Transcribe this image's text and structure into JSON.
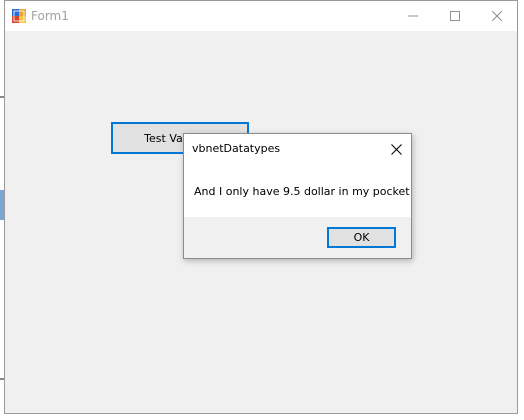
{
  "window": {
    "title": "Form1",
    "controls": {
      "minimize": "minimize-icon",
      "maximize": "maximize-icon",
      "close": "close-icon"
    }
  },
  "form": {
    "button_label": "Test Val"
  },
  "messagebox": {
    "title": "vbnetDatatypes",
    "message": "And I only have 9.5 dollar in my pocket",
    "ok_label": "OK"
  },
  "colors": {
    "accent": "#0078d7",
    "form_bg": "#f0f0f0",
    "button_bg": "#e1e1e1"
  }
}
